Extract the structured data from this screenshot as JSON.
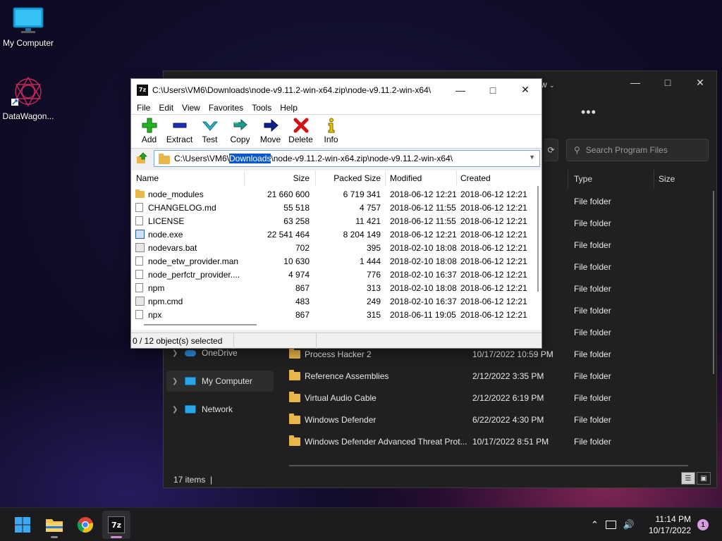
{
  "desktop": {
    "icons": [
      {
        "label": "My Computer"
      },
      {
        "label": "DataWagon..."
      }
    ]
  },
  "explorer": {
    "view_label": "w",
    "search_placeholder": "Search Program Files",
    "columns": {
      "type": "Type",
      "size": "Size"
    },
    "rows": [
      {
        "name": "",
        "date": "",
        "type": "File folder"
      },
      {
        "name": "",
        "date": "",
        "type": "File folder"
      },
      {
        "name": "",
        "date": "",
        "type": "File folder"
      },
      {
        "name": "",
        "date": "",
        "type": "File folder"
      },
      {
        "name": "",
        "date": "",
        "type": "File folder"
      },
      {
        "name": "",
        "date": "",
        "type": "File folder"
      },
      {
        "name": "",
        "date": "",
        "type": "File folder"
      },
      {
        "name": "Process Hacker 2",
        "date": "10/17/2022 10:59 PM",
        "type": "File folder"
      },
      {
        "name": "Reference Assemblies",
        "date": "2/12/2022 3:35 PM",
        "type": "File folder"
      },
      {
        "name": "Virtual Audio Cable",
        "date": "2/12/2022 6:19 PM",
        "type": "File folder"
      },
      {
        "name": "Windows Defender",
        "date": "6/22/2022 4:30 PM",
        "type": "File folder"
      },
      {
        "name": "Windows Defender Advanced Threat Prot...",
        "date": "10/17/2022 8:51 PM",
        "type": "File folder"
      }
    ],
    "nav": [
      {
        "label": "OneDrive"
      },
      {
        "label": "My Computer"
      },
      {
        "label": "Network"
      }
    ],
    "status": "17 items"
  },
  "zip": {
    "app_icon_text": "7z",
    "title": "C:\\Users\\VM6\\Downloads\\node-v9.11.2-win-x64.zip\\node-v9.11.2-win-x64\\",
    "menu": [
      "File",
      "Edit",
      "View",
      "Favorites",
      "Tools",
      "Help"
    ],
    "toolbar": [
      {
        "label": "Add",
        "icon": "plus-icon",
        "color": "#1aa31a"
      },
      {
        "label": "Extract",
        "icon": "minus-icon",
        "color": "#1b2db0"
      },
      {
        "label": "Test",
        "icon": "check-icon",
        "color": "#1fa3b3"
      },
      {
        "label": "Copy",
        "icon": "double-arrow-icon",
        "color": "#1f9c8a"
      },
      {
        "label": "Move",
        "icon": "arrow-right-icon",
        "color": "#0f1f8c"
      },
      {
        "label": "Delete",
        "icon": "x-icon",
        "color": "#d01414"
      },
      {
        "label": "Info",
        "icon": "info-icon",
        "color": "#d9b400"
      }
    ],
    "address": {
      "before": "C:\\Users\\VM6\\",
      "selected": "Downloads",
      "after": "\\node-v9.11.2-win-x64.zip\\node-v9.11.2-win-x64\\"
    },
    "columns": {
      "name": "Name",
      "size": "Size",
      "packed": "Packed Size",
      "modified": "Modified",
      "created": "Created"
    },
    "files": [
      {
        "name": "node_modules",
        "kind": "folder",
        "size": "21 660 600",
        "packed": "6 719 341",
        "modified": "2018-06-12 12:21",
        "created": "2018-06-12 12:21"
      },
      {
        "name": "CHANGELOG.md",
        "kind": "file",
        "size": "55 518",
        "packed": "4 757",
        "modified": "2018-06-12 11:55",
        "created": "2018-06-12 12:21"
      },
      {
        "name": "LICENSE",
        "kind": "file",
        "size": "63 258",
        "packed": "11 421",
        "modified": "2018-06-12 11:55",
        "created": "2018-06-12 12:21"
      },
      {
        "name": "node.exe",
        "kind": "exe",
        "size": "22 541 464",
        "packed": "8 204 149",
        "modified": "2018-06-12 12:21",
        "created": "2018-06-12 12:21"
      },
      {
        "name": "nodevars.bat",
        "kind": "bat",
        "size": "702",
        "packed": "395",
        "modified": "2018-02-10 18:08",
        "created": "2018-06-12 12:21"
      },
      {
        "name": "node_etw_provider.man",
        "kind": "file",
        "size": "10 630",
        "packed": "1 444",
        "modified": "2018-02-10 18:08",
        "created": "2018-06-12 12:21"
      },
      {
        "name": "node_perfctr_provider....",
        "kind": "file",
        "size": "4 974",
        "packed": "776",
        "modified": "2018-02-10 16:37",
        "created": "2018-06-12 12:21"
      },
      {
        "name": "npm",
        "kind": "file",
        "size": "867",
        "packed": "313",
        "modified": "2018-02-10 18:08",
        "created": "2018-06-12 12:21"
      },
      {
        "name": "npm.cmd",
        "kind": "bat",
        "size": "483",
        "packed": "249",
        "modified": "2018-02-10 16:37",
        "created": "2018-06-12 12:21"
      },
      {
        "name": "npx",
        "kind": "file",
        "size": "867",
        "packed": "315",
        "modified": "2018-06-11 19:05",
        "created": "2018-06-12 12:21"
      }
    ],
    "status": "0 / 12 object(s) selected"
  },
  "taskbar": {
    "apps": [
      {
        "name": "start",
        "icon": "windows-logo-icon"
      },
      {
        "name": "file-explorer",
        "icon": "folder-icon"
      },
      {
        "name": "chrome",
        "icon": "chrome-icon"
      },
      {
        "name": "7zip",
        "icon": "7zip-icon",
        "text": "7z"
      }
    ],
    "time": "11:14 PM",
    "date": "10/17/2022",
    "notifications": "1"
  }
}
